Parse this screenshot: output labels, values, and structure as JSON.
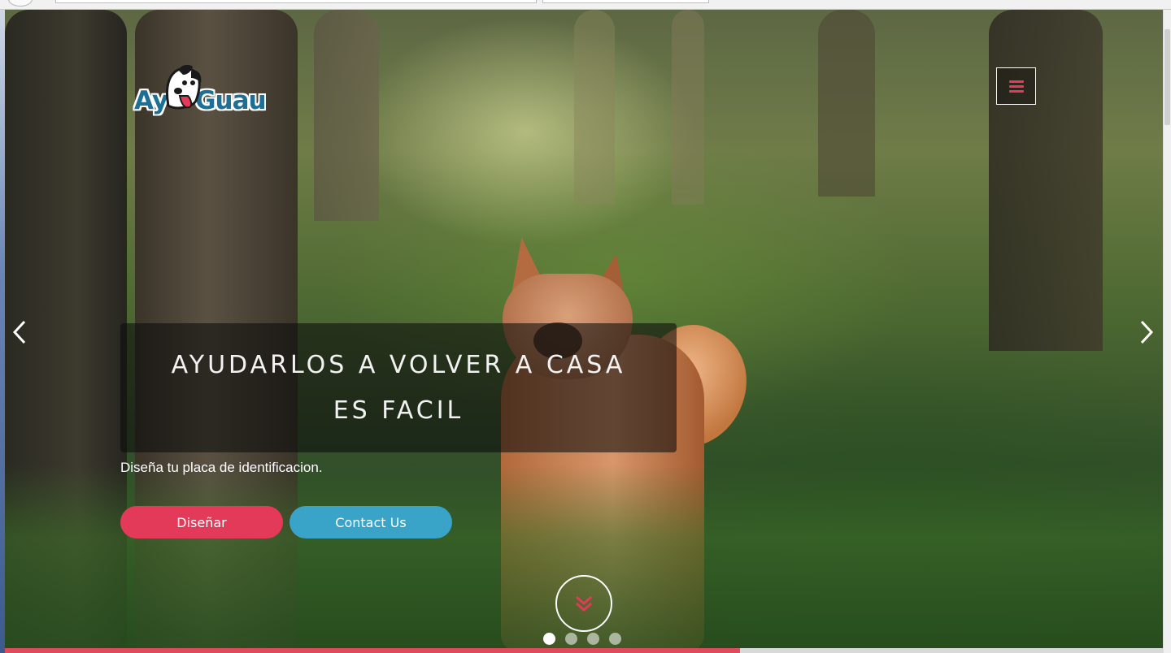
{
  "logo": {
    "text_left": "Ay",
    "text_right": "Guau",
    "icon": "dog-face-icon"
  },
  "menu": {
    "icon": "hamburger-icon",
    "color": "#e8395a"
  },
  "carousel": {
    "prev_icon": "chevron-left-icon",
    "next_icon": "chevron-right-icon",
    "slide_count": 4,
    "active_slide": 1
  },
  "caption": {
    "title": "AYUDARLOS A VOLVER A CASA ES FACIL",
    "subtitle": "Diseña tu placa de identificacion."
  },
  "buttons": {
    "design_label": "Diseñar",
    "contact_label": "Contact Us"
  },
  "scroll_down": {
    "icon": "double-chevron-down-icon"
  },
  "colors": {
    "accent_red": "#e23a58",
    "accent_blue": "#3aa3c8",
    "logo_blue": "#1e6f96"
  },
  "page_scroll_progress": 0.635
}
